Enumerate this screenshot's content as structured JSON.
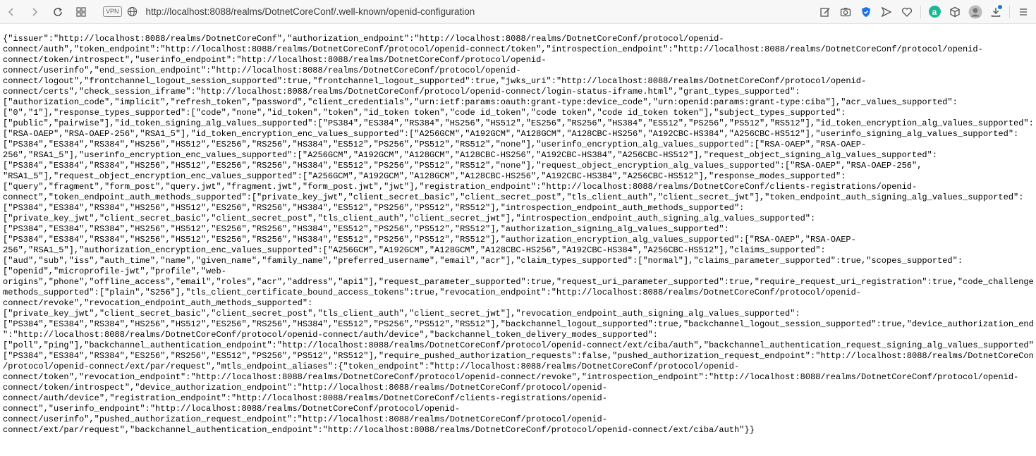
{
  "browser": {
    "vpn_label": "VPN",
    "url": "http://localhost:8088/realms/DotnetCoreConf/.well-known/openid-configuration",
    "icons": [
      "back-icon",
      "forward-icon",
      "reload-icon",
      "tabs-grid-icon",
      "globe-icon",
      "edit-icon",
      "camera-icon",
      "shield-icon",
      "send-icon",
      "heart-icon",
      "extension-a-icon",
      "extension-cube-icon",
      "avatar-icon",
      "download-icon",
      "menu-icon"
    ],
    "extension_a_label": "a"
  },
  "content": {
    "lines": [
      "{\"issuer\":\"http://localhost:8088/realms/DotnetCoreConf\",\"authorization_endpoint\":\"http://localhost:8088/realms/DotnetCoreConf/protocol/openid-",
      "connect/auth\",\"token_endpoint\":\"http://localhost:8088/realms/DotnetCoreConf/protocol/openid-connect/token\",\"introspection_endpoint\":\"http://localhost:8088/realms/DotnetCoreConf/protocol/openid-",
      "connect/token/introspect\",\"userinfo_endpoint\":\"http://localhost:8088/realms/DotnetCoreConf/protocol/openid-",
      "connect/userinfo\",\"end_session_endpoint\":\"http://localhost:8088/realms/DotnetCoreConf/protocol/openid-",
      "connect/logout\",\"frontchannel_logout_session_supported\":true,\"frontchannel_logout_supported\":true,\"jwks_uri\":\"http://localhost:8088/realms/DotnetCoreConf/protocol/openid-",
      "connect/certs\",\"check_session_iframe\":\"http://localhost:8088/realms/DotnetCoreConf/protocol/openid-connect/login-status-iframe.html\",\"grant_types_supported\":",
      "[\"authorization_code\",\"implicit\",\"refresh_token\",\"password\",\"client_credentials\",\"urn:ietf:params:oauth:grant-type:device_code\",\"urn:openid:params:grant-type:ciba\"],\"acr_values_supported\":",
      "[\"0\",\"1\"],\"response_types_supported\":[\"code\",\"none\",\"id_token\",\"token\",\"id_token token\",\"code id_token\",\"code token\",\"code id_token token\"],\"subject_types_supported\":",
      "[\"public\",\"pairwise\"],\"id_token_signing_alg_values_supported\":[\"PS384\",\"ES384\",\"RS384\",\"HS256\",\"HS512\",\"ES256\",\"RS256\",\"HS384\",\"ES512\",\"PS256\",\"PS512\",\"RS512\"],\"id_token_encryption_alg_values_supported\":",
      "[\"RSA-OAEP\",\"RSA-OAEP-256\",\"RSA1_5\"],\"id_token_encryption_enc_values_supported\":[\"A256GCM\",\"A192GCM\",\"A128GCM\",\"A128CBC-HS256\",\"A192CBC-HS384\",\"A256CBC-HS512\"],\"userinfo_signing_alg_values_supported\":",
      "[\"PS384\",\"ES384\",\"RS384\",\"HS256\",\"HS512\",\"ES256\",\"RS256\",\"HS384\",\"ES512\",\"PS256\",\"PS512\",\"RS512\",\"none\"],\"userinfo_encryption_alg_values_supported\":[\"RSA-OAEP\",\"RSA-OAEP-",
      "256\",\"RSA1_5\"],\"userinfo_encryption_enc_values_supported\":[\"A256GCM\",\"A192GCM\",\"A128GCM\",\"A128CBC-HS256\",\"A192CBC-HS384\",\"A256CBC-HS512\"],\"request_object_signing_alg_values_supported\":",
      "[\"PS384\",\"ES384\",\"RS384\",\"HS256\",\"HS512\",\"ES256\",\"RS256\",\"HS384\",\"ES512\",\"PS256\",\"PS512\",\"RS512\",\"none\"],\"request_object_encryption_alg_values_supported\":[\"RSA-OAEP\",\"RSA-OAEP-256\",",
      "\"RSA1_5\"],\"request_object_encryption_enc_values_supported\":[\"A256GCM\",\"A192GCM\",\"A128GCM\",\"A128CBC-HS256\",\"A192CBC-HS384\",\"A256CBC-HS512\"],\"response_modes_supported\":",
      "[\"query\",\"fragment\",\"form_post\",\"query.jwt\",\"fragment.jwt\",\"form_post.jwt\",\"jwt\"],\"registration_endpoint\":\"http://localhost:8088/realms/DotnetCoreConf/clients-registrations/openid-",
      "connect\",\"token_endpoint_auth_methods_supported\":[\"private_key_jwt\",\"client_secret_basic\",\"client_secret_post\",\"tls_client_auth\",\"client_secret_jwt\"],\"token_endpoint_auth_signing_alg_values_supported\":",
      "[\"PS384\",\"ES384\",\"RS384\",\"HS256\",\"HS512\",\"ES256\",\"RS256\",\"HS384\",\"ES512\",\"PS256\",\"PS512\",\"RS512\"],\"introspection_endpoint_auth_methods_supported\":",
      "[\"private_key_jwt\",\"client_secret_basic\",\"client_secret_post\",\"tls_client_auth\",\"client_secret_jwt\"],\"introspection_endpoint_auth_signing_alg_values_supported\":",
      "[\"PS384\",\"ES384\",\"RS384\",\"HS256\",\"HS512\",\"ES256\",\"RS256\",\"HS384\",\"ES512\",\"PS256\",\"PS512\",\"RS512\"],\"authorization_signing_alg_values_supported\":",
      "[\"PS384\",\"ES384\",\"RS384\",\"HS256\",\"HS512\",\"ES256\",\"RS256\",\"HS384\",\"ES512\",\"PS256\",\"PS512\",\"RS512\"],\"authorization_encryption_alg_values_supported\":[\"RSA-OAEP\",\"RSA-OAEP-",
      "256\",\"RSA1_5\"],\"authorization_encryption_enc_values_supported\":[\"A256GCM\",\"A192GCM\",\"A128GCM\",\"A128CBC-HS256\",\"A192CBC-HS384\",\"A256CBC-HS512\"],\"claims_supported\":",
      "[\"aud\",\"sub\",\"iss\",\"auth_time\",\"name\",\"given_name\",\"family_name\",\"preferred_username\",\"email\",\"acr\"],\"claim_types_supported\":[\"normal\"],\"claims_parameter_supported\":true,\"scopes_supported\":",
      "[\"openid\",\"microprofile-jwt\",\"profile\",\"web-",
      "origins\",\"phone\",\"offline_access\",\"email\",\"roles\",\"acr\",\"address\",\"api1\"],\"request_parameter_supported\":true,\"request_uri_parameter_supported\":true,\"require_request_uri_registration\":true,\"code_challenge_",
      "methods_supported\":[\"plain\",\"S256\"],\"tls_client_certificate_bound_access_tokens\":true,\"revocation_endpoint\":\"http://localhost:8088/realms/DotnetCoreConf/protocol/openid-",
      "connect/revoke\",\"revocation_endpoint_auth_methods_supported\":",
      "[\"private_key_jwt\",\"client_secret_basic\",\"client_secret_post\",\"tls_client_auth\",\"client_secret_jwt\"],\"revocation_endpoint_auth_signing_alg_values_supported\":",
      "[\"PS384\",\"ES384\",\"RS384\",\"HS256\",\"HS512\",\"ES256\",\"RS256\",\"HS384\",\"ES512\",\"PS256\",\"PS512\",\"RS512\"],\"backchannel_logout_supported\":true,\"backchannel_logout_session_supported\":true,\"device_authorization_endpoint",
      "\":\"http://localhost:8088/realms/DotnetCoreConf/protocol/openid-connect/auth/device\",\"backchannel_token_delivery_modes_supported\":",
      "[\"poll\",\"ping\"],\"backchannel_authentication_endpoint\":\"http://localhost:8088/realms/DotnetCoreConf/protocol/openid-connect/ext/ciba/auth\",\"backchannel_authentication_request_signing_alg_values_supported\":",
      "[\"PS384\",\"ES384\",\"RS384\",\"ES256\",\"RS256\",\"ES512\",\"PS256\",\"PS512\",\"RS512\"],\"require_pushed_authorization_requests\":false,\"pushed_authorization_request_endpoint\":\"http://localhost:8088/realms/DotnetCoreConf",
      "/protocol/openid-connect/ext/par/request\",\"mtls_endpoint_aliases\":{\"token_endpoint\":\"http://localhost:8088/realms/DotnetCoreConf/protocol/openid-",
      "connect/token\",\"revocation_endpoint\":\"http://localhost:8088/realms/DotnetCoreConf/protocol/openid-connect/revoke\",\"introspection_endpoint\":\"http://localhost:8088/realms/DotnetCoreConf/protocol/openid-",
      "connect/token/introspect\",\"device_authorization_endpoint\":\"http://localhost:8088/realms/DotnetCoreConf/protocol/openid-",
      "connect/auth/device\",\"registration_endpoint\":\"http://localhost:8088/realms/DotnetCoreConf/clients-registrations/openid-",
      "connect\",\"userinfo_endpoint\":\"http://localhost:8088/realms/DotnetCoreConf/protocol/openid-",
      "connect/userinfo\",\"pushed_authorization_request_endpoint\":\"http://localhost:8088/realms/DotnetCoreConf/protocol/openid-",
      "connect/ext/par/request\",\"backchannel_authentication_endpoint\":\"http://localhost:8088/realms/DotnetCoreConf/protocol/openid-connect/ext/ciba/auth\"}}"
    ]
  }
}
